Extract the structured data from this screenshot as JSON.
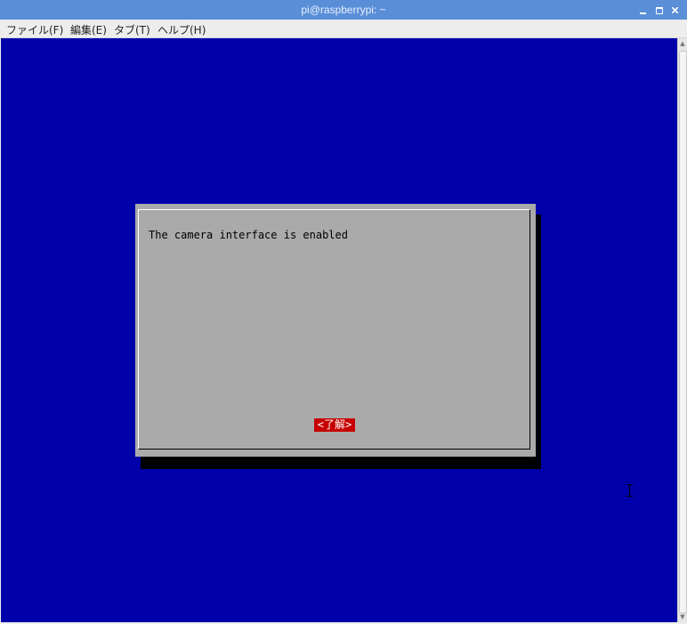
{
  "window": {
    "title": "pi@raspberrypi: ~",
    "controls": {
      "minimize_icon": "minimize-icon",
      "maximize_icon": "maximize-icon",
      "close_icon": "close-icon"
    }
  },
  "menubar": {
    "items": [
      {
        "label": "ファイル(F)"
      },
      {
        "label": "編集(E)"
      },
      {
        "label": "タブ(T)"
      },
      {
        "label": "ヘルプ(H)"
      }
    ]
  },
  "dialog": {
    "message": "The camera interface is enabled",
    "ok_label": "<了解>"
  },
  "colors": {
    "terminal_bg": "#0000aa",
    "dialog_bg": "#aaaaaa",
    "button_bg": "#c60000",
    "titlebar_bg": "#5a8fd8"
  }
}
